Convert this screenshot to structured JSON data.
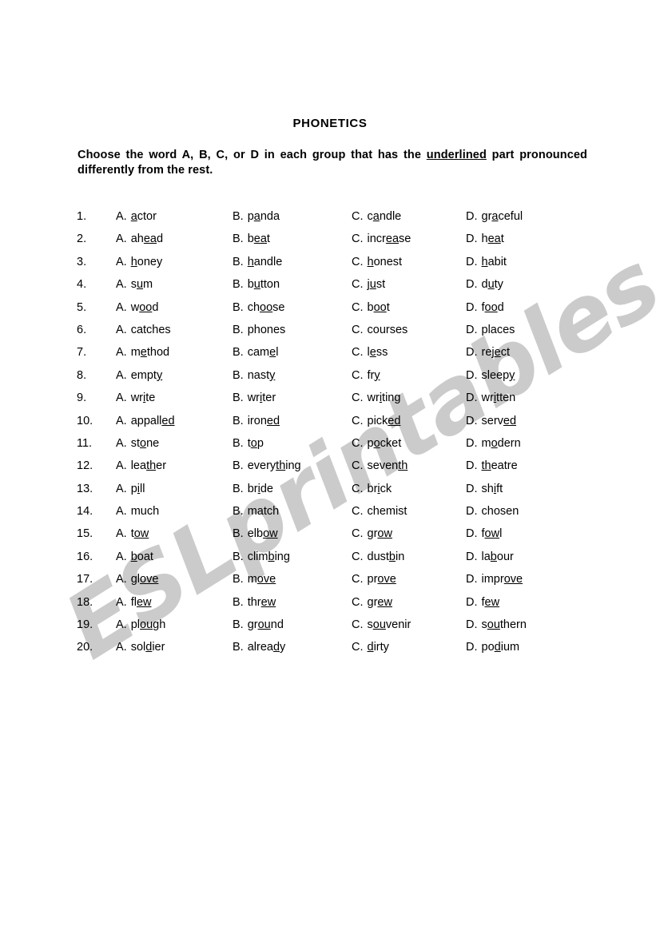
{
  "document": {
    "title": "PHONETICS",
    "instructions_before": "Choose the word A, B, C, or D in each group that has the ",
    "instructions_underlined": "underlined",
    "instructions_after": " part pronounced differently from the rest."
  },
  "watermark": {
    "text": "ESLprintables.com",
    "color": "#c9c9c9"
  },
  "option_letters": [
    "A.",
    "B.",
    "C.",
    "D."
  ],
  "questions": [
    {
      "number": "1.",
      "options": [
        {
          "letter": "A.",
          "pre": "",
          "mark": "a",
          "post": "ctor"
        },
        {
          "letter": "B.",
          "pre": "p",
          "mark": "a",
          "post": "nda"
        },
        {
          "letter": "C.",
          "pre": "c",
          "mark": "a",
          "post": "ndle"
        },
        {
          "letter": "D.",
          "pre": "gr",
          "mark": "a",
          "post": "ceful"
        }
      ]
    },
    {
      "number": "2.",
      "options": [
        {
          "letter": "A.",
          "pre": "ah",
          "mark": "ea",
          "post": "d"
        },
        {
          "letter": "B.",
          "pre": "b",
          "mark": "ea",
          "post": "t"
        },
        {
          "letter": "C.",
          "pre": "incr",
          "mark": "ea",
          "post": "se"
        },
        {
          "letter": "D.",
          "pre": "h",
          "mark": "ea",
          "post": "t"
        }
      ]
    },
    {
      "number": "3.",
      "options": [
        {
          "letter": "A.",
          "pre": "",
          "mark": "h",
          "post": "oney"
        },
        {
          "letter": "B.",
          "pre": "",
          "mark": "h",
          "post": "andle"
        },
        {
          "letter": "C.",
          "pre": "",
          "mark": "h",
          "post": "onest"
        },
        {
          "letter": "D.",
          "pre": "",
          "mark": "h",
          "post": "abit"
        }
      ]
    },
    {
      "number": "4.",
      "options": [
        {
          "letter": "A.",
          "pre": "s",
          "mark": "u",
          "post": "m"
        },
        {
          "letter": "B.",
          "pre": "b",
          "mark": "u",
          "post": "tton"
        },
        {
          "letter": "C.",
          "pre": "j",
          "mark": "u",
          "post": "st"
        },
        {
          "letter": "D.",
          "pre": "d",
          "mark": "u",
          "post": "ty"
        }
      ]
    },
    {
      "number": "5.",
      "options": [
        {
          "letter": "A.",
          "pre": "w",
          "mark": "oo",
          "post": "d"
        },
        {
          "letter": "B.",
          "pre": "ch",
          "mark": "oo",
          "post": "se"
        },
        {
          "letter": "C.",
          "pre": "b",
          "mark": "oo",
          "post": "t"
        },
        {
          "letter": "D.",
          "pre": "f",
          "mark": "oo",
          "post": "d"
        }
      ]
    },
    {
      "number": "6.",
      "options": [
        {
          "letter": "A.",
          "pre": "catches",
          "mark": "",
          "post": ""
        },
        {
          "letter": "B.",
          "pre": "phones",
          "mark": "",
          "post": ""
        },
        {
          "letter": "C.",
          "pre": "courses",
          "mark": "",
          "post": ""
        },
        {
          "letter": "D.",
          "pre": "places",
          "mark": "",
          "post": ""
        }
      ]
    },
    {
      "number": "7.",
      "options": [
        {
          "letter": "A.",
          "pre": "m",
          "mark": "e",
          "post": "thod"
        },
        {
          "letter": "B.",
          "pre": "cam",
          "mark": "e",
          "post": "l"
        },
        {
          "letter": "C.",
          "pre": "l",
          "mark": "e",
          "post": "ss"
        },
        {
          "letter": "D.",
          "pre": "rej",
          "mark": "e",
          "post": "ct"
        }
      ]
    },
    {
      "number": "8.",
      "options": [
        {
          "letter": "A.",
          "pre": "empt",
          "mark": "y",
          "post": ""
        },
        {
          "letter": "B.",
          "pre": "nast",
          "mark": "y",
          "post": ""
        },
        {
          "letter": "C.",
          "pre": "fr",
          "mark": "y",
          "post": ""
        },
        {
          "letter": "D.",
          "pre": "sleep",
          "mark": "y",
          "post": ""
        }
      ]
    },
    {
      "number": "9.",
      "options": [
        {
          "letter": "A.",
          "pre": "wr",
          "mark": "i",
          "post": "te"
        },
        {
          "letter": "B.",
          "pre": "wr",
          "mark": "i",
          "post": "ter"
        },
        {
          "letter": "C.",
          "pre": "wr",
          "mark": "i",
          "post": "ting"
        },
        {
          "letter": "D.",
          "pre": "wr",
          "mark": "i",
          "post": "tten"
        }
      ]
    },
    {
      "number": "10.",
      "options": [
        {
          "letter": "A.",
          "pre": "appall",
          "mark": "ed",
          "post": ""
        },
        {
          "letter": "B.",
          "pre": "iron",
          "mark": "ed",
          "post": ""
        },
        {
          "letter": "C.",
          "pre": "pick",
          "mark": "ed",
          "post": ""
        },
        {
          "letter": "D.",
          "pre": "serv",
          "mark": "ed",
          "post": ""
        }
      ]
    },
    {
      "number": "11.",
      "options": [
        {
          "letter": "A.",
          "pre": "st",
          "mark": "o",
          "post": "ne"
        },
        {
          "letter": "B.",
          "pre": "t",
          "mark": "o",
          "post": "p"
        },
        {
          "letter": "C.",
          "pre": "p",
          "mark": "o",
          "post": "cket"
        },
        {
          "letter": "D.",
          "pre": "m",
          "mark": "o",
          "post": "dern"
        }
      ]
    },
    {
      "number": "12.",
      "options": [
        {
          "letter": "A.",
          "pre": "lea",
          "mark": "th",
          "post": "er"
        },
        {
          "letter": "B.",
          "pre": "every",
          "mark": "th",
          "post": "ing"
        },
        {
          "letter": "C.",
          "pre": "seven",
          "mark": "th",
          "post": ""
        },
        {
          "letter": "D.",
          "pre": "",
          "mark": "th",
          "post": "eatre"
        }
      ]
    },
    {
      "number": "13.",
      "options": [
        {
          "letter": "A.",
          "pre": "p",
          "mark": "i",
          "post": "ll"
        },
        {
          "letter": "B.",
          "pre": "br",
          "mark": "i",
          "post": "de"
        },
        {
          "letter": "C.",
          "pre": "br",
          "mark": "i",
          "post": "ck"
        },
        {
          "letter": "D.",
          "pre": "sh",
          "mark": "i",
          "post": "ft"
        }
      ]
    },
    {
      "number": "14.",
      "options": [
        {
          "letter": "A.",
          "pre": "much",
          "mark": "",
          "post": ""
        },
        {
          "letter": "B.",
          "pre": "match",
          "mark": "",
          "post": ""
        },
        {
          "letter": "C.",
          "pre": "chemist",
          "mark": "",
          "post": ""
        },
        {
          "letter": "D.",
          "pre": "chosen",
          "mark": "",
          "post": ""
        }
      ]
    },
    {
      "number": "15.",
      "options": [
        {
          "letter": "A.",
          "pre": "t",
          "mark": "ow",
          "post": ""
        },
        {
          "letter": "B.",
          "pre": "elb",
          "mark": "ow",
          "post": ""
        },
        {
          "letter": "C.",
          "pre": "gr",
          "mark": "ow",
          "post": ""
        },
        {
          "letter": "D.",
          "pre": "f",
          "mark": "ow",
          "post": "l"
        }
      ]
    },
    {
      "number": "16.",
      "options": [
        {
          "letter": "A.",
          "pre": "",
          "mark": "b",
          "post": "oat"
        },
        {
          "letter": "B.",
          "pre": "clim",
          "mark": "b",
          "post": "ing"
        },
        {
          "letter": "C.",
          "pre": "dust",
          "mark": "b",
          "post": "in"
        },
        {
          "letter": "D.",
          "pre": "la",
          "mark": "b",
          "post": "our"
        }
      ]
    },
    {
      "number": "17.",
      "options": [
        {
          "letter": "A.",
          "pre": "gl",
          "mark": "ove",
          "post": ""
        },
        {
          "letter": "B.",
          "pre": "m",
          "mark": "ove",
          "post": ""
        },
        {
          "letter": "C.",
          "pre": "pr",
          "mark": "ove",
          "post": ""
        },
        {
          "letter": "D.",
          "pre": "impr",
          "mark": "ove",
          "post": ""
        }
      ]
    },
    {
      "number": "18.",
      "options": [
        {
          "letter": "A.",
          "pre": "fl",
          "mark": "ew",
          "post": ""
        },
        {
          "letter": "B.",
          "pre": "thr",
          "mark": "ew",
          "post": ""
        },
        {
          "letter": "C.",
          "pre": "gr",
          "mark": "ew",
          "post": ""
        },
        {
          "letter": "D.",
          "pre": "f",
          "mark": "ew",
          "post": ""
        }
      ]
    },
    {
      "number": "19.",
      "options": [
        {
          "letter": "A.",
          "pre": "pl",
          "mark": "ou",
          "post": "gh"
        },
        {
          "letter": "B.",
          "pre": "gr",
          "mark": "ou",
          "post": "nd"
        },
        {
          "letter": "C.",
          "pre": "s",
          "mark": "ou",
          "post": "venir"
        },
        {
          "letter": "D.",
          "pre": "s",
          "mark": "ou",
          "post": "thern"
        }
      ]
    },
    {
      "number": "20.",
      "options": [
        {
          "letter": "A.",
          "pre": "sol",
          "mark": "d",
          "post": "ier"
        },
        {
          "letter": "B.",
          "pre": "alrea",
          "mark": "d",
          "post": "y"
        },
        {
          "letter": "C.",
          "pre": "",
          "mark": "d",
          "post": "irty"
        },
        {
          "letter": "D.",
          "pre": "po",
          "mark": "d",
          "post": "ium"
        }
      ]
    }
  ]
}
